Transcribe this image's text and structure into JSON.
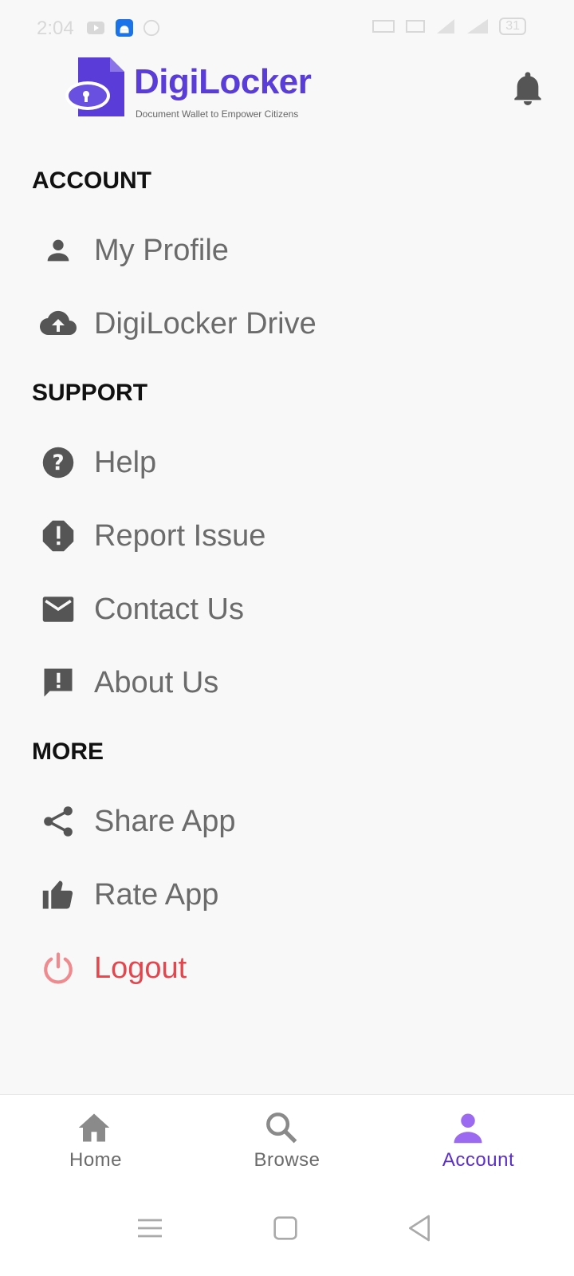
{
  "status_bar": {
    "time": "2:04",
    "battery": "31"
  },
  "header": {
    "brand": "DigiLocker",
    "tagline": "Document Wallet to Empower Citizens",
    "brand_color": "#5a3dd8"
  },
  "sections": {
    "account": {
      "title": "ACCOUNT",
      "items": [
        {
          "label": "My Profile",
          "icon": "person-icon"
        },
        {
          "label": "DigiLocker Drive",
          "icon": "cloud-upload-icon"
        }
      ]
    },
    "support": {
      "title": "SUPPORT",
      "items": [
        {
          "label": "Help",
          "icon": "help-circle-icon"
        },
        {
          "label": "Report Issue",
          "icon": "report-icon"
        },
        {
          "label": "Contact Us",
          "icon": "mail-icon"
        },
        {
          "label": "About Us",
          "icon": "feedback-icon"
        }
      ]
    },
    "more": {
      "title": "MORE",
      "items": [
        {
          "label": "Share App",
          "icon": "share-icon"
        },
        {
          "label": "Rate App",
          "icon": "thumb-up-icon"
        },
        {
          "label": "Logout",
          "icon": "power-icon"
        }
      ]
    }
  },
  "bottom_nav": {
    "home": "Home",
    "browse": "Browse",
    "account": "Account",
    "active": "account",
    "active_color": "#5b2fc8",
    "logout_color": "#e5464d"
  }
}
